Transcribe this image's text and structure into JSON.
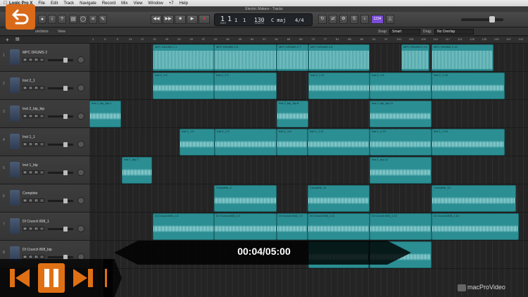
{
  "menubar": {
    "app": "Logic Pro X",
    "items": [
      "File",
      "Edit",
      "Track",
      "Navigate",
      "Record",
      "Mix",
      "View",
      "Window",
      "+7",
      "Help"
    ]
  },
  "window": {
    "title": "Electric Makers - Tracks"
  },
  "lcd": {
    "bar": "1",
    "beat": "1",
    "sub": "1",
    "tick": "1",
    "tempo": "130",
    "key": "C maj",
    "signature": "4/4",
    "time_label": "BAR",
    "tempo_label": "TEMPO"
  },
  "control_tools": {
    "purple_label": "1234"
  },
  "trackbar": {
    "functions_label": "unctions",
    "view_label": "View",
    "snap_label": "Snap:",
    "snap_value": "Smart",
    "drag_label": "Drag:",
    "drag_value": "No Overlap"
  },
  "ruler_numbers": [
    "1",
    "5",
    "9",
    "13",
    "17",
    "21",
    "25",
    "29",
    "33",
    "37",
    "41",
    "45",
    "49",
    "53",
    "57",
    "61",
    "65",
    "69",
    "73",
    "77",
    "81",
    "85",
    "89",
    "93",
    "97",
    "101",
    "105",
    "109",
    "113",
    "117",
    "121",
    "125",
    "129",
    "133",
    "137",
    "141",
    "145",
    "149"
  ],
  "tracks": [
    {
      "num": "1",
      "name": "MPC DRUMS 2"
    },
    {
      "num": "2",
      "name": "Inst 2_1"
    },
    {
      "num": "3",
      "name": "Inst 2_bip_bip"
    },
    {
      "num": "4",
      "name": "Inst 1_1"
    },
    {
      "num": "5",
      "name": "Inst 1_bip"
    },
    {
      "num": "6",
      "name": "Complete"
    },
    {
      "num": "7",
      "name": "DI Crunch 808_1"
    },
    {
      "num": "8",
      "name": "DI Crunch 808_bip"
    }
  ],
  "track_buttons": [
    "M",
    "S",
    "R",
    "I"
  ],
  "regions": [
    {
      "lane": 0,
      "label": "MPC DRUMS 2.1"
    },
    {
      "lane": 0,
      "label": "MPC DRUMS 2.6"
    },
    {
      "lane": 0,
      "label": "MPC DRUMS 2.7"
    },
    {
      "lane": 0,
      "label": "MPC DRUMS 2.8"
    },
    {
      "lane": 0,
      "label": "MPC DRUMS 2.13"
    },
    {
      "lane": 0,
      "label": "MPC DRUMS 2.15"
    },
    {
      "lane": 1,
      "label": "Inst 2_1.6"
    },
    {
      "lane": 1,
      "label": "Inst 2_1.3"
    },
    {
      "lane": 1,
      "label": "Inst 2_1.11"
    },
    {
      "lane": 1,
      "label": "Inst 2_1.8"
    },
    {
      "lane": 1,
      "label": "Inst 2_1.16"
    },
    {
      "lane": 2,
      "label": "Inst 2_bip_bip.1"
    },
    {
      "lane": 2,
      "label": "Inst 2_bip_bip.8"
    },
    {
      "lane": 2,
      "label": "Inst 2_bip_bip.11"
    },
    {
      "lane": 3,
      "label": "Inst 1_1.6"
    },
    {
      "lane": 3,
      "label": "Inst 1_1.3"
    },
    {
      "lane": 3,
      "label": "Inst 1_1.8"
    },
    {
      "lane": 3,
      "label": "Inst 1_1.11"
    },
    {
      "lane": 3,
      "label": "Inst 1_1.13"
    },
    {
      "lane": 3,
      "label": "Inst 1_1.16"
    },
    {
      "lane": 4,
      "label": "Inst 1_bip.7"
    },
    {
      "lane": 4,
      "label": "Inst 1_bip.12"
    },
    {
      "lane": 5,
      "label": "Complete_3"
    },
    {
      "lane": 5,
      "label": "Complete_11"
    },
    {
      "lane": 5,
      "label": "Complete_14"
    },
    {
      "lane": 6,
      "label": "DI Crunch 808_1.6"
    },
    {
      "lane": 6,
      "label": "DI Crunch 808_1.3"
    },
    {
      "lane": 6,
      "label": "DI Crunch 808_1.9"
    },
    {
      "lane": 6,
      "label": "DI Crunch 808_1.11"
    },
    {
      "lane": 6,
      "label": "DI Crunch 808_1.13"
    },
    {
      "lane": 6,
      "label": "DI Crunch 808_1.16"
    },
    {
      "lane": 7,
      "label": ""
    },
    {
      "lane": 7,
      "label": ""
    }
  ],
  "player": {
    "timecode": "00:04/05:00",
    "watermark": "macProVideo",
    "progress": 0.0133
  },
  "colors": {
    "region": "#2b8e93",
    "accent": "#e07014",
    "purple": "#7b4bd6"
  }
}
